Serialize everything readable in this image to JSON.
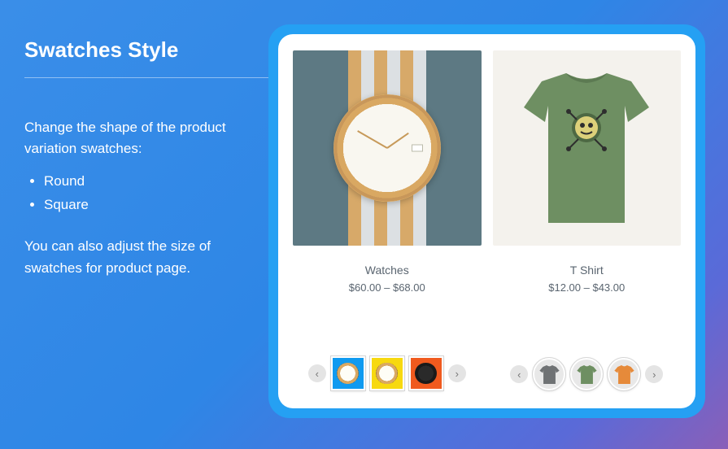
{
  "left": {
    "title": "Swatches Style",
    "intro": "Change the shape of the product variation swatches:",
    "options": [
      "Round",
      "Square"
    ],
    "note": "You can also adjust the size of swatches for product page."
  },
  "products": [
    {
      "title": "Watches",
      "price": "$60.00 – $68.00",
      "swatch_shape": "square",
      "swatches": [
        {
          "bg": "#0f9af0",
          "variant": "light"
        },
        {
          "bg": "#f7d90f",
          "variant": "light"
        },
        {
          "bg": "#f05a1e",
          "variant": "dark"
        }
      ]
    },
    {
      "title": "T Shirt",
      "price": "$12.00 – $43.00",
      "swatch_shape": "round",
      "swatches": [
        {
          "bg": "#e8e8e8",
          "fill": "#6f7274"
        },
        {
          "bg": "#e8e8e8",
          "fill": "#6e8f62"
        },
        {
          "bg": "#e8e8e8",
          "fill": "#e68a3a"
        }
      ]
    }
  ],
  "arrows": {
    "prev": "‹",
    "next": "›"
  }
}
